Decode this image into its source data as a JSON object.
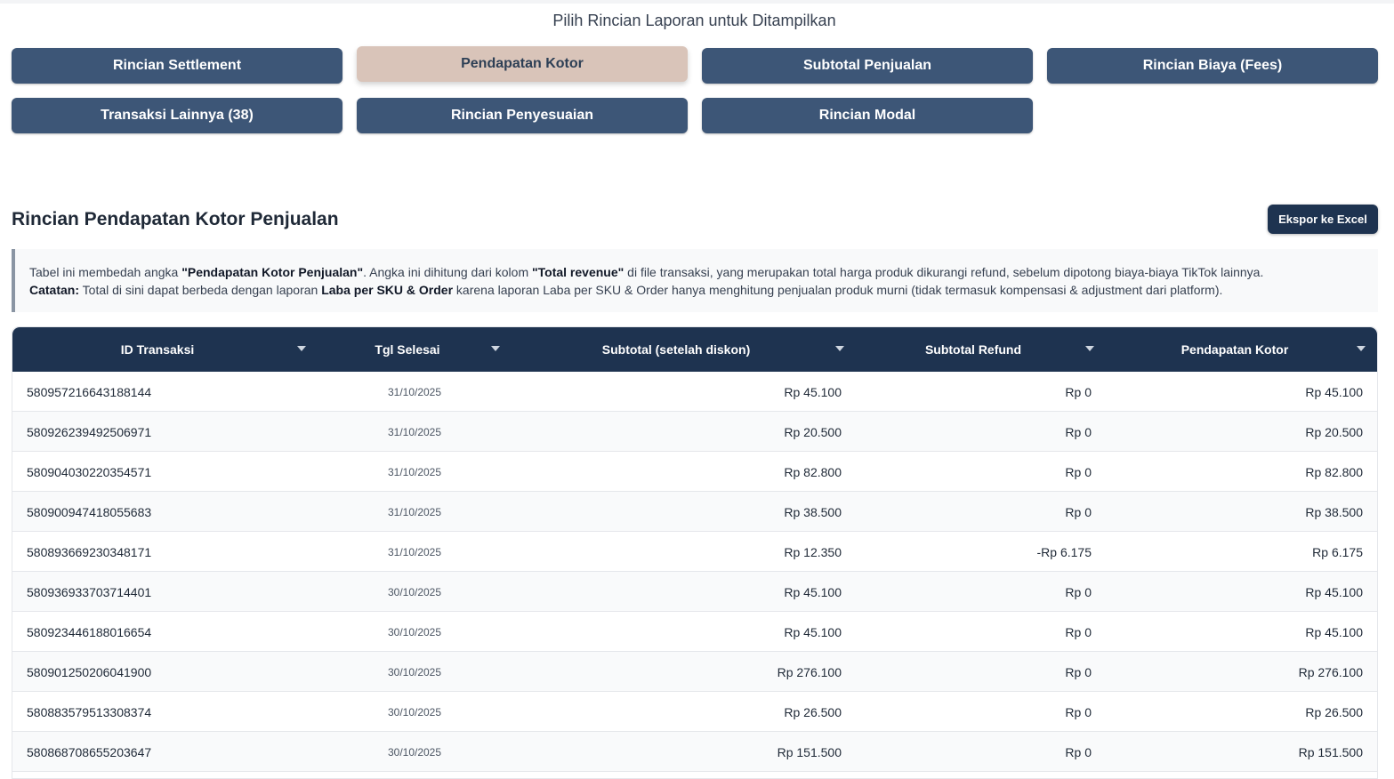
{
  "selector": {
    "title": "Pilih Rincian Laporan untuk Ditampilkan",
    "buttons": [
      {
        "label": "Rincian Settlement",
        "active": false
      },
      {
        "label": "Pendapatan Kotor",
        "active": true
      },
      {
        "label": "Subtotal Penjualan",
        "active": false
      },
      {
        "label": "Rincian Biaya (Fees)",
        "active": false
      },
      {
        "label": "Transaksi Lainnya (38)",
        "active": false
      },
      {
        "label": "Rincian Penyesuaian",
        "active": false
      },
      {
        "label": "Rincian Modal",
        "active": false
      }
    ]
  },
  "section": {
    "title": "Rincian Pendapatan Kotor Penjualan",
    "export_label": "Ekspor ke Excel"
  },
  "note": {
    "line1_a": "Tabel ini membedah angka ",
    "line1_b": "\"Pendapatan Kotor Penjualan\"",
    "line1_c": ". Angka ini dihitung dari kolom ",
    "line1_d": "\"Total revenue\"",
    "line1_e": " di file transaksi, yang merupakan total harga produk dikurangi refund, sebelum dipotong biaya-biaya TikTok lainnya.",
    "line2_a": "Catatan:",
    "line2_b": " Total di sini dapat berbeda dengan laporan ",
    "line2_c": "Laba per SKU & Order",
    "line2_d": " karena laporan Laba per SKU & Order hanya menghitung penjualan produk murni (tidak termasuk kompensasi & adjustment dari platform)."
  },
  "table": {
    "columns": [
      "ID Transaksi",
      "Tgl Selesai",
      "Subtotal (setelah diskon)",
      "Subtotal Refund",
      "Pendapatan Kotor"
    ],
    "rows": [
      [
        "580957216643188144",
        "31/10/2025",
        "Rp 45.100",
        "Rp 0",
        "Rp 45.100"
      ],
      [
        "580926239492506971",
        "31/10/2025",
        "Rp 20.500",
        "Rp 0",
        "Rp 20.500"
      ],
      [
        "580904030220354571",
        "31/10/2025",
        "Rp 82.800",
        "Rp 0",
        "Rp 82.800"
      ],
      [
        "580900947418055683",
        "31/10/2025",
        "Rp 38.500",
        "Rp 0",
        "Rp 38.500"
      ],
      [
        "580893669230348171",
        "31/10/2025",
        "Rp 12.350",
        "-Rp 6.175",
        "Rp 6.175"
      ],
      [
        "580936933703714401",
        "30/10/2025",
        "Rp 45.100",
        "Rp 0",
        "Rp 45.100"
      ],
      [
        "580923446188016654",
        "30/10/2025",
        "Rp 45.100",
        "Rp 0",
        "Rp 45.100"
      ],
      [
        "580901250206041900",
        "30/10/2025",
        "Rp 276.100",
        "Rp 0",
        "Rp 276.100"
      ],
      [
        "580883579513308374",
        "30/10/2025",
        "Rp 26.500",
        "Rp 0",
        "Rp 26.500"
      ],
      [
        "580868708655203647",
        "30/10/2025",
        "Rp 151.500",
        "Rp 0",
        "Rp 151.500"
      ]
    ]
  }
}
